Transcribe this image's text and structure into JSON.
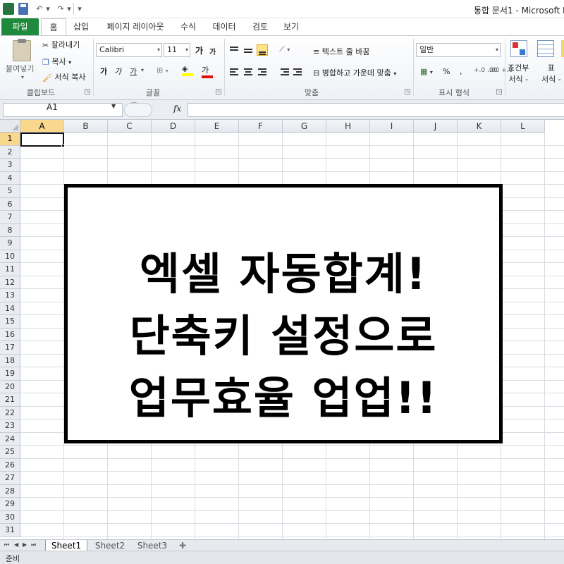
{
  "titlebar": {
    "title": "통합 문서1 - Microsoft E",
    "excel_logo": "X"
  },
  "tabs": {
    "file": "파일",
    "home": "홈",
    "insert": "삽입",
    "layout": "페이지 레이아웃",
    "formula": "수식",
    "data": "데이터",
    "review": "검토",
    "view": "보기"
  },
  "ribbon": {
    "clipboard": {
      "title": "클립보드",
      "paste": "붙여넣기",
      "cut": "잘라내기",
      "copy": "복사",
      "format_painter": "서식 복사"
    },
    "font": {
      "title": "글꼴",
      "font_name": "Calibri",
      "font_size": "11",
      "grow": "가",
      "shrink": "가",
      "bold": "가",
      "italic": "가",
      "underline": "가",
      "font_color_glyph": "가",
      "fill_color": "#ffff00",
      "font_color": "#e01010"
    },
    "alignment": {
      "title": "맞춤",
      "wrap_text": "텍스트 줄 바꿈",
      "merge_center": "병합하고 가운데 맞춤"
    },
    "number": {
      "title": "표시 형식",
      "format": "일반",
      "percent": "%",
      "comma": ",",
      "inc_decimal": "+.0 .00",
      "dec_decimal": ".00 +.0"
    },
    "styles": {
      "conditional": "조건부\n서식 -",
      "table": "표\n서식 -"
    }
  },
  "formula_bar": {
    "name_box": "A1",
    "fx": "fx",
    "value": ""
  },
  "grid": {
    "columns": [
      "A",
      "B",
      "C",
      "D",
      "E",
      "F",
      "G",
      "H",
      "I",
      "J",
      "K",
      "L"
    ],
    "rows": [
      "1",
      "2",
      "3",
      "4",
      "5",
      "6",
      "7",
      "8",
      "9",
      "10",
      "11",
      "12",
      "13",
      "14",
      "15",
      "16",
      "17",
      "18",
      "19",
      "20",
      "21",
      "22",
      "23",
      "24",
      "25",
      "26",
      "27",
      "28",
      "29",
      "30",
      "31"
    ],
    "active_cell": "A1"
  },
  "overlay": {
    "line1": "엑셀 자동합계!",
    "line2": "단축키 설정으로",
    "line3": "업무효율 업업!!"
  },
  "sheets": {
    "tabs": [
      "Sheet1",
      "Sheet2",
      "Sheet3"
    ]
  },
  "status": {
    "text": "준비"
  }
}
